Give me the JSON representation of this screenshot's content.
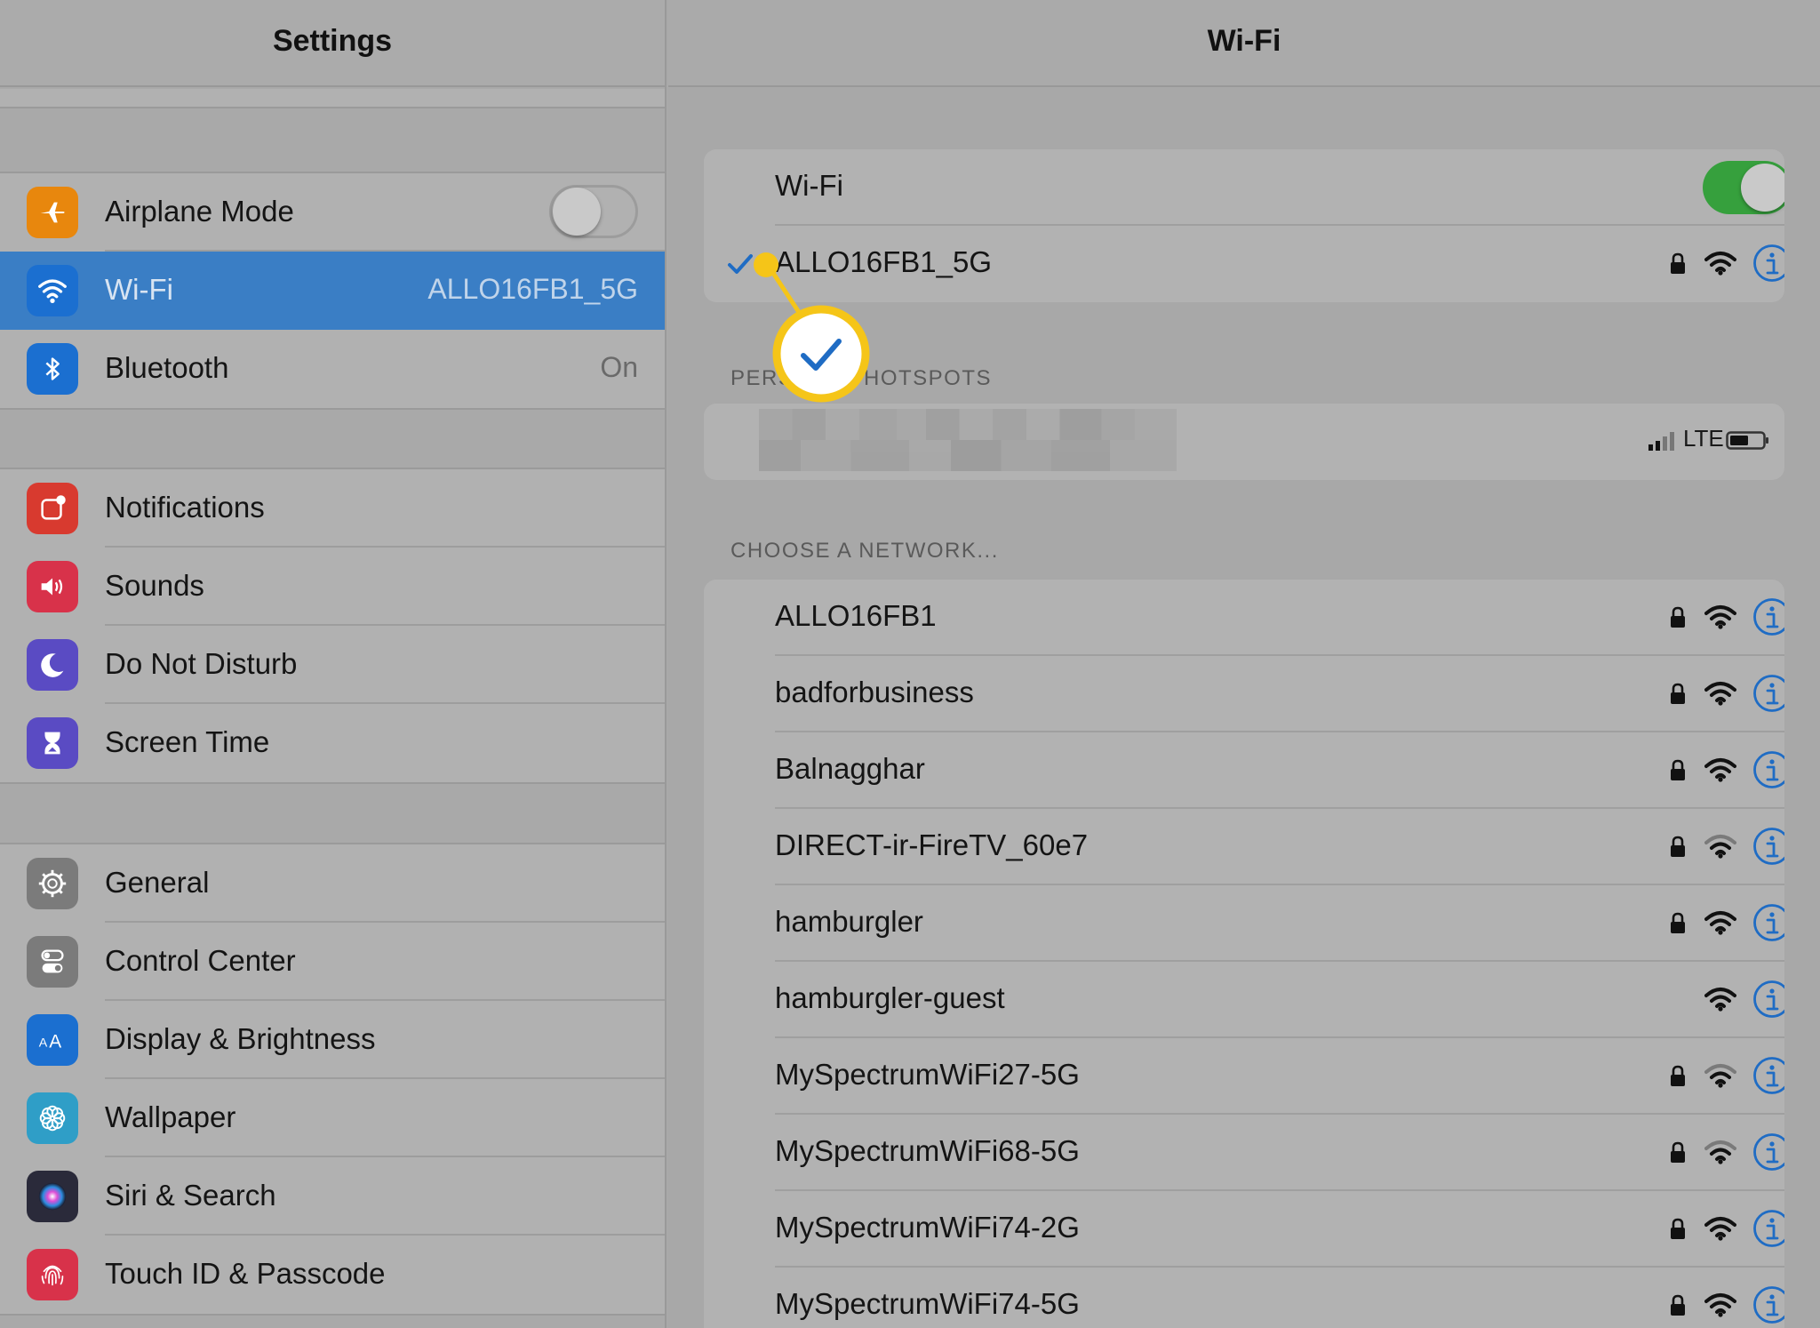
{
  "sidebar": {
    "title": "Settings",
    "groups": [
      [
        {
          "label": "Airplane Mode",
          "icon": "airplane-icon",
          "color": "#e8870d",
          "value": "",
          "toggle": "off"
        },
        {
          "label": "Wi-Fi",
          "icon": "wifi-icon",
          "color": "#1b6fd0",
          "value": "ALLO16FB1_5G",
          "selected": true
        },
        {
          "label": "Bluetooth",
          "icon": "bluetooth-icon",
          "color": "#1b6fd0",
          "value": "On"
        }
      ],
      [
        {
          "label": "Notifications",
          "icon": "notifications-icon",
          "color": "#d83a2f",
          "value": ""
        },
        {
          "label": "Sounds",
          "icon": "speaker-icon",
          "color": "#d8324a",
          "value": ""
        },
        {
          "label": "Do Not Disturb",
          "icon": "moon-icon",
          "color": "#5a4bc3",
          "value": ""
        },
        {
          "label": "Screen Time",
          "icon": "hourglass-icon",
          "color": "#5a4bc3",
          "value": ""
        }
      ],
      [
        {
          "label": "General",
          "icon": "gear-icon",
          "color": "#7b7b7b",
          "value": ""
        },
        {
          "label": "Control Center",
          "icon": "switches-icon",
          "color": "#7b7b7b",
          "value": ""
        },
        {
          "label": "Display & Brightness",
          "icon": "text-size-icon",
          "color": "#1b6fd0",
          "value": ""
        },
        {
          "label": "Wallpaper",
          "icon": "flower-icon",
          "color": "#2f9ec7",
          "value": ""
        },
        {
          "label": "Siri & Search",
          "icon": "siri-icon",
          "color": "#2a2a3a",
          "value": ""
        },
        {
          "label": "Touch ID & Passcode",
          "icon": "fingerprint-icon",
          "color": "#d8324a",
          "value": ""
        }
      ]
    ]
  },
  "wifi": {
    "title": "Wi-Fi",
    "toggle_label": "Wi-Fi",
    "toggle_state": "on",
    "connected": {
      "name": "ALLO16FB1_5G",
      "locked": true,
      "signal": "full"
    },
    "hotspots_label": "PERSONAL HOTSPOTS",
    "hotspot": {
      "cellular": "LTE"
    },
    "choose_label": "CHOOSE A NETWORK...",
    "networks": [
      {
        "name": "ALLO16FB1",
        "locked": true,
        "signal": "full"
      },
      {
        "name": "badforbusiness",
        "locked": true,
        "signal": "full"
      },
      {
        "name": "Balnagghar",
        "locked": true,
        "signal": "full"
      },
      {
        "name": "DIRECT-ir-FireTV_60e7",
        "locked": true,
        "signal": "weak"
      },
      {
        "name": "hamburgler",
        "locked": true,
        "signal": "full"
      },
      {
        "name": "hamburgler-guest",
        "locked": false,
        "signal": "full"
      },
      {
        "name": "MySpectrumWiFi27-5G",
        "locked": true,
        "signal": "weak"
      },
      {
        "name": "MySpectrumWiFi68-5G",
        "locked": true,
        "signal": "weak"
      },
      {
        "name": "MySpectrumWiFi74-2G",
        "locked": true,
        "signal": "full"
      },
      {
        "name": "MySpectrumWiFi74-5G",
        "locked": true,
        "signal": "full"
      }
    ]
  },
  "colors": {
    "accent": "#3a7ec5",
    "info_blue": "#1f6cc4",
    "toggle_on": "#36a03d",
    "callout_yellow": "#f5c518"
  }
}
